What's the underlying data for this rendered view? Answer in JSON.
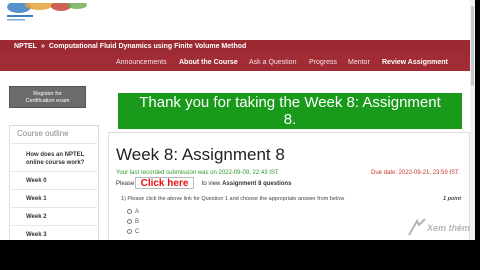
{
  "brand": {
    "bar_color": "#9b2a33",
    "nav_color": "#a22c36",
    "banner_color": "#1a9a1a",
    "due_color": "#c0392b",
    "submitted_color": "#2a9a2a",
    "click_color": "#e01010"
  },
  "header": {
    "org": "NPTEL",
    "separator": "»",
    "course": "Computational Fluid Dynamics using Finite Volume Method"
  },
  "nav": [
    {
      "label": "Announcements"
    },
    {
      "label": "About the Course"
    },
    {
      "label": "Ask a Question"
    },
    {
      "label": "Progress"
    },
    {
      "label": "Mentor"
    },
    {
      "label": "Review Assignment"
    }
  ],
  "sidebar": {
    "register_line1": "Register for",
    "register_line2": "Certification exam",
    "outline_title": "Course outline",
    "items": [
      {
        "label": "How does an NPTEL online course work?"
      },
      {
        "label": "Week 0"
      },
      {
        "label": "Week 1"
      },
      {
        "label": "Week 2"
      },
      {
        "label": "Week 3"
      }
    ]
  },
  "main": {
    "banner_line1": "Thank you for taking the Week 8: Assignment",
    "banner_line2": "8.",
    "title": "Week 8: Assignment 8",
    "submitted": "Your last recorded submission was on 2022-09-09, 22:43 IST",
    "due": "Due date: 2022-09-21, 23:59 IST.",
    "please": "Please",
    "click_here": "Click here",
    "to_view": "to view",
    "view_target": "Assignment 8 questions",
    "question": "1)   Please click the above link for Question 1 and choose the appropriate answer from below",
    "points": "1 point",
    "options": [
      "A",
      "B",
      "C"
    ]
  },
  "watermark": {
    "text": "Xem thêm"
  }
}
